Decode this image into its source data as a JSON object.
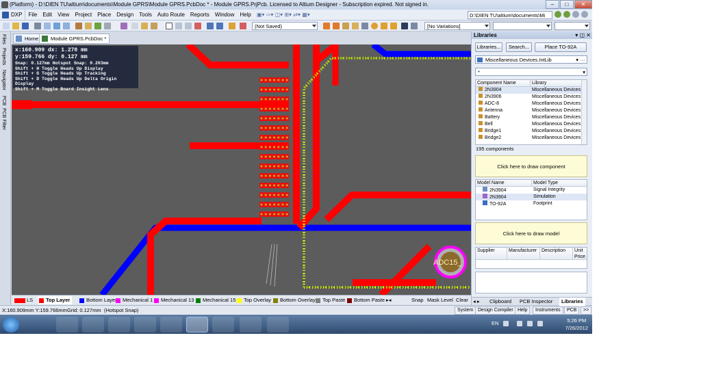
{
  "window": {
    "title": "(Platform) - D:\\DIEN TU\\altium\\documents\\Module GPRS\\Module GPRS.PcbDoc * - Module GPRS.PrjPcb. Licensed to Altium Designer - Subscription expired. Not signed in."
  },
  "menu": {
    "dxp": "DXP",
    "items": [
      "File",
      "Edit",
      "View",
      "Project",
      "Place",
      "Design",
      "Tools",
      "Auto Route",
      "Reports",
      "Window",
      "Help"
    ],
    "path": "D:\\DIEN TU\\altium\\documents\\Mi"
  },
  "toolbar": {
    "saved_state": "(Not Saved)",
    "variations": "[No Variations]"
  },
  "left_tabs": [
    "Files",
    "Projects",
    "Navigator",
    "PCB",
    "PCB Filter"
  ],
  "doc_tabs": [
    "Home",
    "Module GPRS.PcbDoc *"
  ],
  "hud": {
    "line1": "x:160.909   dx:  1.270 mm",
    "line2": "y:159.766   dy:  0.127 mm",
    "lines": [
      "Snap: 0.127mm Hotspot Snap: 0.203mm",
      "Shift + H  Toggle Heads Up Display",
      "Shift + G  Toggle Heads Up Tracking",
      "Shift + D  Toggle Heads Up Delta Origin Display",
      "Shift + M  Toggle Board Insight Lens"
    ]
  },
  "pcb": {
    "component_label": "ADC15_"
  },
  "layers": {
    "ls": "LS",
    "items": [
      {
        "label": "Top Layer",
        "color": "#ff0000",
        "active": true
      },
      {
        "label": "Bottom Layer",
        "color": "#0000ff"
      },
      {
        "label": "Mechanical 1",
        "color": "#ff00ff"
      },
      {
        "label": "Mechanical 13",
        "color": "#ff00ff"
      },
      {
        "label": "Mechanical 15",
        "color": "#008000"
      },
      {
        "label": "Top Overlay",
        "color": "#ffff00"
      },
      {
        "label": "Bottom Overlay",
        "color": "#808000"
      },
      {
        "label": "Top Paste",
        "color": "#808080"
      },
      {
        "label": "Bottom Paste",
        "color": "#800000"
      }
    ],
    "right_buttons": [
      "Snap",
      "Mask Level",
      "Clear"
    ]
  },
  "status": {
    "coords": "X:160.909mm Y:159.766mm",
    "grid": "Grid: 0.127mm",
    "snap": "(Hotspot Snap)",
    "buttons": [
      "System",
      "Design Compiler",
      "Help",
      "Instruments",
      "PCB",
      ">>"
    ]
  },
  "libraries": {
    "title": "Libraries",
    "buttons": [
      "Libraries...",
      "Search...",
      "Place TO-92A"
    ],
    "library": "Miscellaneous Devices.IntLib",
    "filter": "*",
    "columns": [
      "Component Name",
      "Library"
    ],
    "components": [
      {
        "name": "2N3904",
        "lib": "Miscellaneous Devices"
      },
      {
        "name": "2N3906",
        "lib": "Miscellaneous Devices"
      },
      {
        "name": "ADC-8",
        "lib": "Miscellaneous Devices"
      },
      {
        "name": "Antenna",
        "lib": "Miscellaneous Devices"
      },
      {
        "name": "Battery",
        "lib": "Miscellaneous Devices"
      },
      {
        "name": "Bell",
        "lib": "Miscellaneous Devices"
      },
      {
        "name": "Bridge1",
        "lib": "Miscellaneous Devices"
      },
      {
        "name": "Bridge2",
        "lib": "Miscellaneous Devices"
      }
    ],
    "count": "195 components",
    "draw_component": "Click here to draw component",
    "model_columns": [
      "Model Name",
      "Model Type"
    ],
    "models": [
      {
        "name": "2N3904",
        "type": "Signal Integrity"
      },
      {
        "name": "2N3904",
        "type": "Simulation"
      },
      {
        "name": "TO-92A",
        "type": "Footprint"
      }
    ],
    "draw_model": "Click here to draw model",
    "supplier_columns": [
      "Supplier",
      "Manufacturer",
      "Description",
      "Unit Price"
    ],
    "bottom_tabs": [
      "Clipboard",
      "PCB Inspector",
      "Libraries"
    ]
  },
  "taskbar": {
    "lang": "EN",
    "time": "5:26 PM",
    "date": "7/26/2012"
  }
}
